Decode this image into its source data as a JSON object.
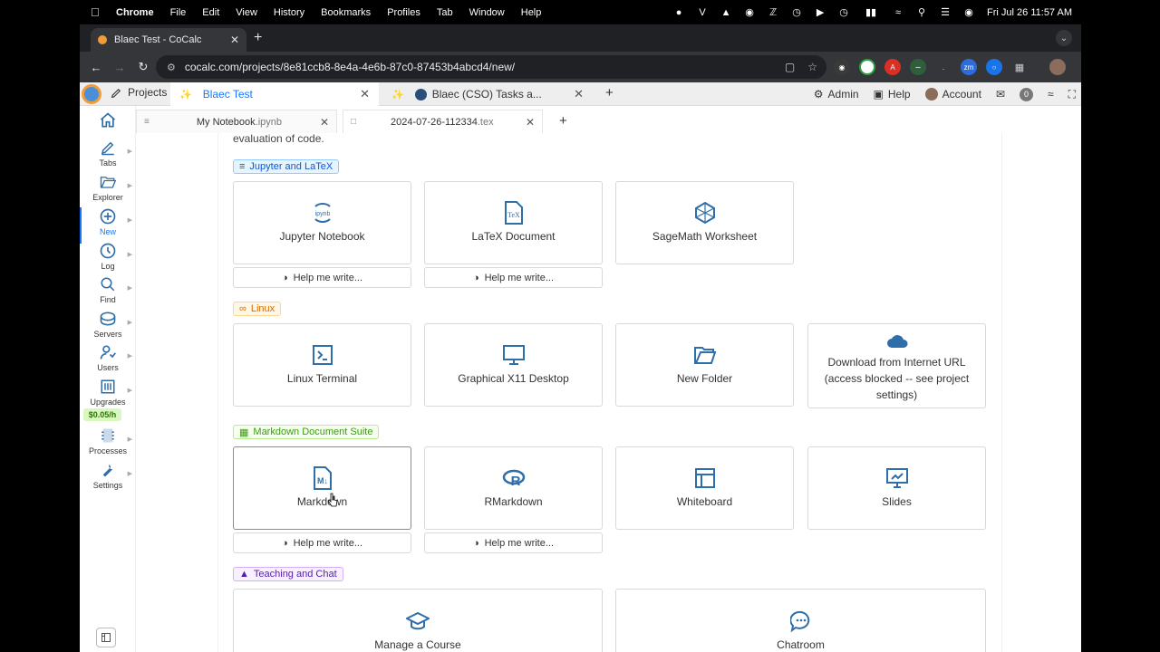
{
  "menubar": {
    "app": "Chrome",
    "items": [
      "File",
      "Edit",
      "View",
      "History",
      "Bookmarks",
      "Profiles",
      "Tab",
      "Window",
      "Help"
    ],
    "clock": "Fri Jul 26  11:57 AM"
  },
  "browser": {
    "tab_title": "Blaec Test - CoCalc",
    "url": "cocalc.com/projects/8e81ccb8-8e4a-4e6b-87c0-87453b4abcd4/new/"
  },
  "cocalc": {
    "projects_label": "Projects",
    "project_tabs": [
      {
        "label": "Blaec Test"
      },
      {
        "label": "Blaec (CSO) Tasks a..."
      }
    ],
    "right": {
      "admin": "Admin",
      "help": "Help",
      "account": "Account",
      "notifications": "0"
    }
  },
  "leftnav": {
    "items": [
      {
        "label": "Tabs"
      },
      {
        "label": "Explorer"
      },
      {
        "label": "New"
      },
      {
        "label": "Log"
      },
      {
        "label": "Find"
      },
      {
        "label": "Servers"
      },
      {
        "label": "Users"
      },
      {
        "label": "Upgrades"
      },
      {
        "label": "Processes"
      },
      {
        "label": "Settings"
      }
    ],
    "price": "$0.05/h"
  },
  "filetabs": [
    {
      "name": "My Notebook",
      "ext": ".ipynb"
    },
    {
      "name": "2024-07-26-112334",
      "ext": ".tex"
    }
  ],
  "content": {
    "intro": "evaluation of code.",
    "sections": {
      "jupyter": "Jupyter and LaTeX",
      "linux": "Linux",
      "markdown": "Markdown Document Suite",
      "teaching": "Teaching and Chat"
    },
    "cards": {
      "jupyter_notebook": "Jupyter Notebook",
      "latex_document": "LaTeX Document",
      "sagemath_worksheet": "SageMath Worksheet",
      "linux_terminal": "Linux Terminal",
      "x11_desktop": "Graphical X11 Desktop",
      "new_folder": "New Folder",
      "download_url_line1": "Download from Internet URL",
      "download_url_line2": "(access blocked -- see project",
      "download_url_line3": "settings)",
      "markdown": "Markdown",
      "rmarkdown": "RMarkdown",
      "whiteboard": "Whiteboard",
      "slides": "Slides",
      "manage_course": "Manage a Course",
      "chatroom": "Chatroom"
    },
    "help_label": "Help me write..."
  },
  "colors": {
    "accent": "#1677ff",
    "icon_blue": "#2f6ea8"
  }
}
